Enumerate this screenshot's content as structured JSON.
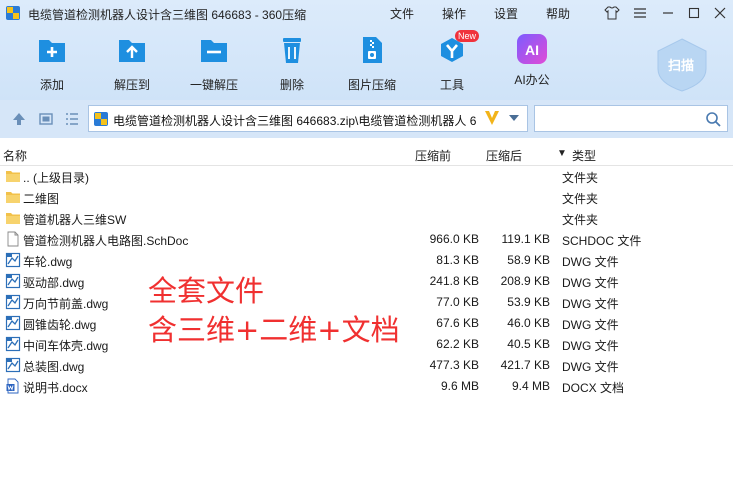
{
  "window": {
    "title": "电缆管道检测机器人设计含三维图 646683 - 360压缩",
    "menu": {
      "file": "文件",
      "operate": "操作",
      "settings": "设置",
      "help": "帮助"
    }
  },
  "toolbar": {
    "add": "添加",
    "extract": "解压到",
    "one_click": "一键解压",
    "delete": "删除",
    "image_compress": "图片压缩",
    "tools": "工具",
    "tools_badge": "New",
    "ai_office": "AI办公",
    "ai_icon_text": "AI",
    "scan": "扫描"
  },
  "address": {
    "path": "电缆管道检测机器人设计含三维图 646683.zip\\电缆管道检测机器人 6",
    "search_value": ""
  },
  "columns": {
    "name": "名称",
    "size": "压缩前",
    "compressed": "压缩后",
    "type": "类型",
    "sort_arrow": "▼"
  },
  "files": [
    {
      "name": ".. (上级目录)",
      "size": "",
      "compressed": "",
      "type": "文件夹",
      "icon": "folder-icon"
    },
    {
      "name": "二维图",
      "size": "",
      "compressed": "",
      "type": "文件夹",
      "icon": "folder-icon"
    },
    {
      "name": "管道机器人三维SW",
      "size": "",
      "compressed": "",
      "type": "文件夹",
      "icon": "folder-icon"
    },
    {
      "name": "管道检测机器人电路图.SchDoc",
      "size": "966.0 KB",
      "compressed": "119.1 KB",
      "type": "SCHDOC 文件",
      "icon": "document-icon"
    },
    {
      "name": "车轮.dwg",
      "size": "81.3 KB",
      "compressed": "58.9 KB",
      "type": "DWG 文件",
      "icon": "dwg-file-icon"
    },
    {
      "name": "驱动部.dwg",
      "size": "241.8 KB",
      "compressed": "208.9 KB",
      "type": "DWG 文件",
      "icon": "dwg-file-icon"
    },
    {
      "name": "万向节前盖.dwg",
      "size": "77.0 KB",
      "compressed": "53.9 KB",
      "type": "DWG 文件",
      "icon": "dwg-file-icon"
    },
    {
      "name": "圆锥齿轮.dwg",
      "size": "67.6 KB",
      "compressed": "46.0 KB",
      "type": "DWG 文件",
      "icon": "dwg-file-icon"
    },
    {
      "name": "中间车体壳.dwg",
      "size": "62.2 KB",
      "compressed": "40.5 KB",
      "type": "DWG 文件",
      "icon": "dwg-file-icon"
    },
    {
      "name": "总装图.dwg",
      "size": "477.3 KB",
      "compressed": "421.7 KB",
      "type": "DWG 文件",
      "icon": "dwg-file-icon"
    },
    {
      "name": "说明书.docx",
      "size": "9.6 MB",
      "compressed": "9.4 MB",
      "type": "DOCX 文档",
      "icon": "word-doc-icon"
    }
  ],
  "overlay": {
    "line1": "全套文件",
    "line2": "含三维+二维+文档"
  },
  "colors": {
    "toolbar_blue": "#1e8fe0",
    "overlay_red": "#f03030"
  }
}
